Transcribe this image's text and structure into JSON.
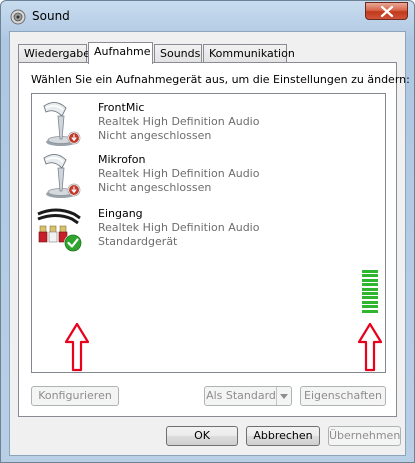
{
  "window": {
    "title": "Sound",
    "close_icon": "close-icon"
  },
  "tabs": [
    {
      "label": "Wiedergabe",
      "active": false
    },
    {
      "label": "Aufnahme",
      "active": true
    },
    {
      "label": "Sounds",
      "active": false
    },
    {
      "label": "Kommunikation",
      "active": false
    }
  ],
  "panel": {
    "instruction": "Wählen Sie ein Aufnahmegerät aus, um die Einstellungen zu ändern:"
  },
  "devices": [
    {
      "name": "FrontMic",
      "driver": "Realtek High Definition Audio",
      "status": "Nicht angeschlossen",
      "icon": "microphone-disconnected-icon"
    },
    {
      "name": "Mikrofon",
      "driver": "Realtek High Definition Audio",
      "status": "Nicht angeschlossen",
      "icon": "microphone-disconnected-icon"
    },
    {
      "name": "Eingang",
      "driver": "Realtek High Definition Audio",
      "status": "Standardgerät",
      "icon": "line-in-cable-default-icon",
      "level": 1.0
    }
  ],
  "buttons": {
    "configure": "Konfigurieren",
    "set_default": "Als Standard",
    "properties": "Eigenschaften",
    "ok": "OK",
    "cancel": "Abbrechen",
    "apply": "Übernehmen"
  },
  "colors": {
    "annotation_arrow": "#e8001c",
    "level_green": "#2fb52f",
    "default_check": "#2fa52f",
    "disconnected_badge": "#c0392b"
  }
}
